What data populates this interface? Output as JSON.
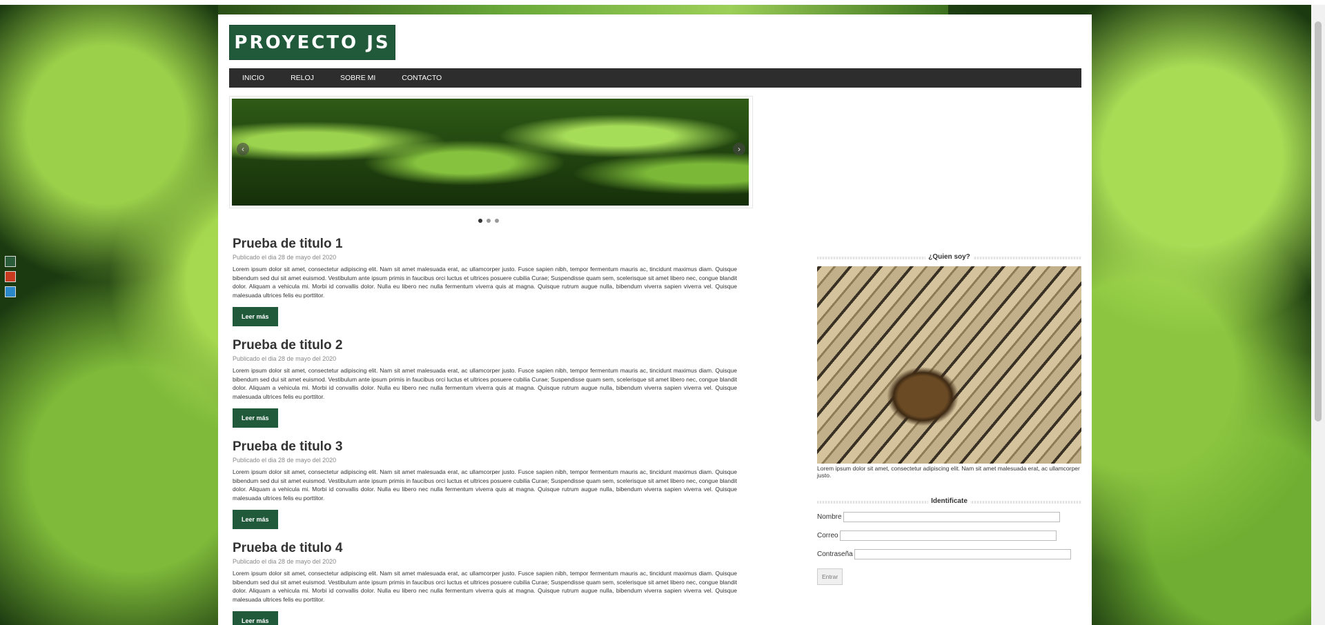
{
  "theme_colors": {
    "accent": "#215a3b",
    "nav_bg": "#2d2d2d",
    "swatch_green": "#2a5c3a",
    "swatch_red": "#c83a20",
    "swatch_blue": "#2b88c8"
  },
  "header": {
    "logo": "PROYECTO JS"
  },
  "nav": {
    "items": [
      "INICIO",
      "RELOJ",
      "SOBRE MI",
      "CONTACTO"
    ]
  },
  "slider": {
    "prev_icon": "‹",
    "next_icon": "›",
    "slide_count": 3,
    "active_index": 0
  },
  "posts": [
    {
      "title": "Prueba de titulo 1",
      "date": "Publicado el dia 28 de mayo del 2020",
      "body": "Lorem ipsum dolor sit amet, consectetur adipiscing elit. Nam sit amet malesuada erat, ac ullamcorper justo. Fusce sapien nibh, tempor fermentum mauris ac, tincidunt maximus diam. Quisque bibendum sed dui sit amet euismod. Vestibulum ante ipsum primis in faucibus orci luctus et ultrices posuere cubilia Curae; Suspendisse quam sem, scelerisque sit amet libero nec, congue blandit dolor. Aliquam a vehicula mi. Morbi id convallis dolor. Nulla eu libero nec nulla fermentum viverra quis at magna. Quisque rutrum augue nulla, bibendum viverra sapien viverra vel. Quisque malesuada ultrices felis eu porttitor.",
      "button": "Leer más"
    },
    {
      "title": "Prueba de titulo 2",
      "date": "Publicado el dia 28 de mayo del 2020",
      "body": "Lorem ipsum dolor sit amet, consectetur adipiscing elit. Nam sit amet malesuada erat, ac ullamcorper justo. Fusce sapien nibh, tempor fermentum mauris ac, tincidunt maximus diam. Quisque bibendum sed dui sit amet euismod. Vestibulum ante ipsum primis in faucibus orci luctus et ultrices posuere cubilia Curae; Suspendisse quam sem, scelerisque sit amet libero nec, congue blandit dolor. Aliquam a vehicula mi. Morbi id convallis dolor. Nulla eu libero nec nulla fermentum viverra quis at magna. Quisque rutrum augue nulla, bibendum viverra sapien viverra vel. Quisque malesuada ultrices felis eu porttitor.",
      "button": "Leer más"
    },
    {
      "title": "Prueba de titulo 3",
      "date": "Publicado el dia 28 de mayo del 2020",
      "body": "Lorem ipsum dolor sit amet, consectetur adipiscing elit. Nam sit amet malesuada erat, ac ullamcorper justo. Fusce sapien nibh, tempor fermentum mauris ac, tincidunt maximus diam. Quisque bibendum sed dui sit amet euismod. Vestibulum ante ipsum primis in faucibus orci luctus et ultrices posuere cubilia Curae; Suspendisse quam sem, scelerisque sit amet libero nec, congue blandit dolor. Aliquam a vehicula mi. Morbi id convallis dolor. Nulla eu libero nec nulla fermentum viverra quis at magna. Quisque rutrum augue nulla, bibendum viverra sapien viverra vel. Quisque malesuada ultrices felis eu porttitor.",
      "button": "Leer más"
    },
    {
      "title": "Prueba de titulo 4",
      "date": "Publicado el dia 28 de mayo del 2020",
      "body": "Lorem ipsum dolor sit amet, consectetur adipiscing elit. Nam sit amet malesuada erat, ac ullamcorper justo. Fusce sapien nibh, tempor fermentum mauris ac, tincidunt maximus diam. Quisque bibendum sed dui sit amet euismod. Vestibulum ante ipsum primis in faucibus orci luctus et ultrices posuere cubilia Curae; Suspendisse quam sem, scelerisque sit amet libero nec, congue blandit dolor. Aliquam a vehicula mi. Morbi id convallis dolor. Nulla eu libero nec nulla fermentum viverra quis at magna. Quisque rutrum augue nulla, bibendum viverra sapien viverra vel. Quisque malesuada ultrices felis eu porttitor.",
      "button": "Leer más"
    }
  ],
  "sidebar": {
    "about": {
      "title": "¿Quien soy?",
      "caption": "Lorem ipsum dolor sit amet, consectetur adipiscing elit. Nam sit amet malesuada erat, ac ullamcorper justo."
    },
    "login": {
      "title": "Identificate",
      "name_label": "Nombre",
      "email_label": "Correo",
      "password_label": "Contraseña",
      "submit": "Entrar"
    }
  }
}
